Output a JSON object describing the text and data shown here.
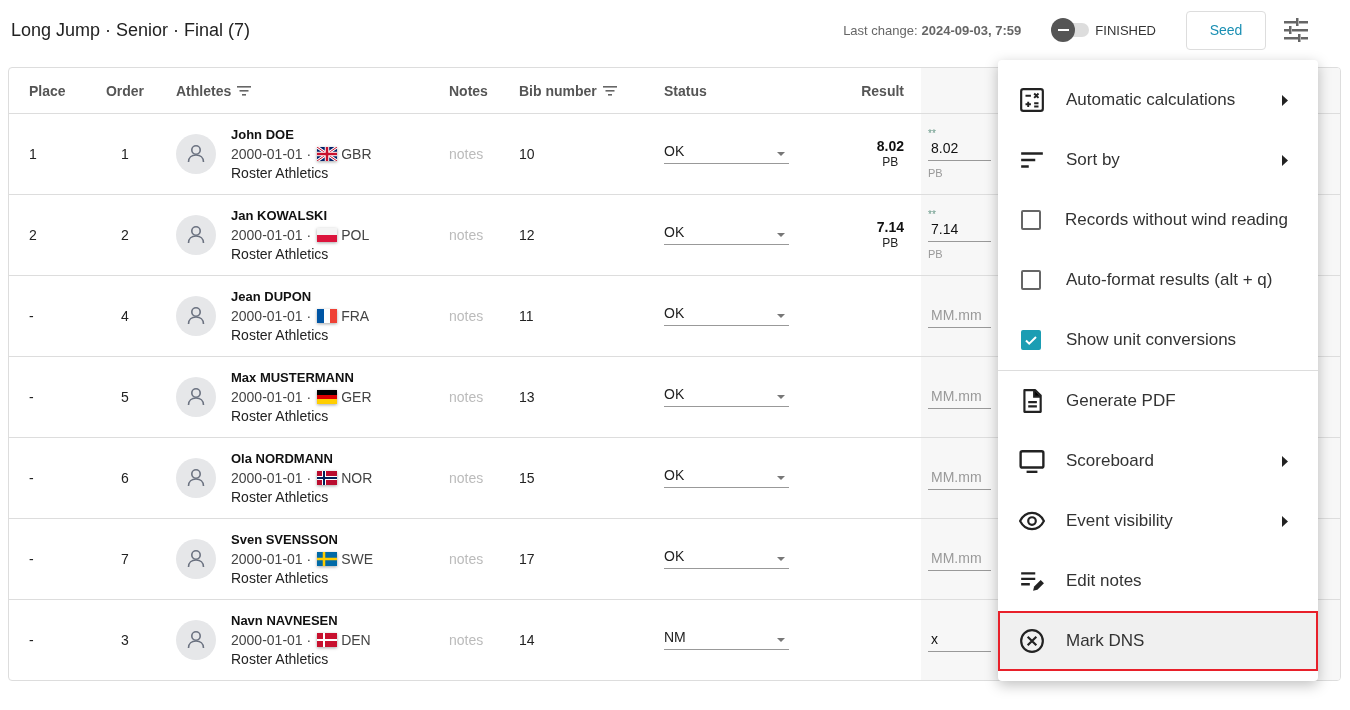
{
  "header": {
    "title": "Long Jump · Senior · Final (7)",
    "last_change_label": "Last change:",
    "last_change_value": "2024-09-03, 7:59",
    "finished_toggle": {
      "label": "FINISHED",
      "on": false
    },
    "seed_button": "Seed"
  },
  "table": {
    "columns": [
      {
        "label": "Place",
        "filter": false
      },
      {
        "label": "Order",
        "filter": false
      },
      {
        "label": "Athletes",
        "filter": true
      },
      {
        "label": "Notes",
        "filter": false
      },
      {
        "label": "Bib number",
        "filter": true
      },
      {
        "label": "Status",
        "filter": false
      },
      {
        "label": "Result",
        "filter": false
      }
    ],
    "rows": [
      {
        "place": "1",
        "order": "1",
        "name": "John DOE",
        "dob": "2000-01-01 ·",
        "country": "GBR",
        "club": "Roster Athletics",
        "notes_placeholder": "notes",
        "bib": "10",
        "status": "OK",
        "result": "8.02",
        "result_note": "PB",
        "attempt": {
          "mark": "**",
          "value": "8.02",
          "note": "PB"
        }
      },
      {
        "place": "2",
        "order": "2",
        "name": "Jan KOWALSKI",
        "dob": "2000-01-01 ·",
        "country": "POL",
        "club": "Roster Athletics",
        "notes_placeholder": "notes",
        "bib": "12",
        "status": "OK",
        "result": "7.14",
        "result_note": "PB",
        "attempt": {
          "mark": "**",
          "value": "7.14",
          "note": "PB"
        }
      },
      {
        "place": "-",
        "order": "4",
        "name": "Jean DUPON",
        "dob": "2000-01-01 ·",
        "country": "FRA",
        "club": "Roster Athletics",
        "notes_placeholder": "notes",
        "bib": "11",
        "status": "OK",
        "attempt": {
          "placeholder": "MM.mm"
        }
      },
      {
        "place": "-",
        "order": "5",
        "name": "Max MUSTERMANN",
        "dob": "2000-01-01 ·",
        "country": "GER",
        "club": "Roster Athletics",
        "notes_placeholder": "notes",
        "bib": "13",
        "status": "OK",
        "attempt": {
          "placeholder": "MM.mm"
        }
      },
      {
        "place": "-",
        "order": "6",
        "name": "Ola NORDMANN",
        "dob": "2000-01-01 ·",
        "country": "NOR",
        "club": "Roster Athletics",
        "notes_placeholder": "notes",
        "bib": "15",
        "status": "OK",
        "attempt": {
          "placeholder": "MM.mm"
        }
      },
      {
        "place": "-",
        "order": "7",
        "name": "Sven SVENSSON",
        "dob": "2000-01-01 ·",
        "country": "SWE",
        "club": "Roster Athletics",
        "notes_placeholder": "notes",
        "bib": "17",
        "status": "OK",
        "attempt": {
          "placeholder": "MM.mm"
        }
      },
      {
        "place": "-",
        "order": "3",
        "name": "Navn NAVNESEN",
        "dob": "2000-01-01 ·",
        "country": "DEN",
        "club": "Roster Athletics",
        "notes_placeholder": "notes",
        "bib": "14",
        "status": "NM",
        "attempt": {
          "value": "x"
        }
      }
    ]
  },
  "menu": {
    "items": [
      {
        "kind": "submenu",
        "label": "Automatic calculations"
      },
      {
        "kind": "submenu",
        "label": "Sort by"
      },
      {
        "kind": "checkbox",
        "label": "Records without wind reading",
        "checked": false
      },
      {
        "kind": "checkbox",
        "label": "Auto-format results (alt + q)",
        "checked": false
      },
      {
        "kind": "checkbox",
        "label": "Show unit conversions",
        "checked": true
      },
      {
        "kind": "action",
        "label": "Generate PDF",
        "divider_before": true
      },
      {
        "kind": "submenu",
        "label": "Scoreboard"
      },
      {
        "kind": "submenu",
        "label": "Event visibility"
      },
      {
        "kind": "action",
        "label": "Edit notes"
      },
      {
        "kind": "action",
        "label": "Mark DNS",
        "highlighted": true
      }
    ]
  }
}
